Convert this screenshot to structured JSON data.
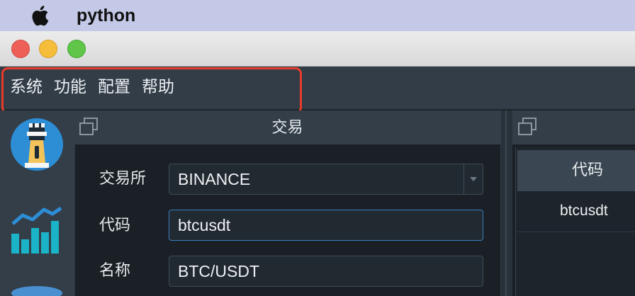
{
  "os_menubar": {
    "app_name": "python"
  },
  "app_menu": {
    "items": [
      "系统",
      "功能",
      "配置",
      "帮助"
    ]
  },
  "left_toolbar": {
    "icons": [
      "trade-tower-icon",
      "bar-line-chart-icon",
      "database-icon"
    ]
  },
  "trade_dock": {
    "title": "交易",
    "fields": {
      "exchange": {
        "label": "交易所",
        "value": "BINANCE"
      },
      "symbol": {
        "label": "代码",
        "value": "btcusdt"
      },
      "name": {
        "label": "名称",
        "value": "BTC/USDT"
      }
    }
  },
  "right_dock": {
    "table": {
      "columns": [
        "代码"
      ],
      "rows": [
        [
          "btcusdt"
        ]
      ]
    }
  },
  "colors": {
    "highlight_box": "#e83c2a",
    "focus_border": "#3b7fc2",
    "menubar_bg": "#c3c9e6"
  }
}
